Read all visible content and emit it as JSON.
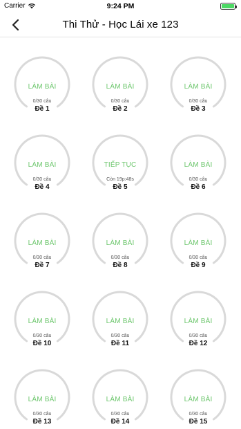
{
  "status_bar": {
    "carrier": "Carrier",
    "time": "9:24 PM"
  },
  "nav": {
    "title": "Thi Thử - Học Lái xe 123"
  },
  "exams": [
    {
      "action": "LÀM BÀI",
      "progress": "0/30 câu",
      "name": "Đề 1"
    },
    {
      "action": "LÀM BÀI",
      "progress": "0/30 câu",
      "name": "Đề 2"
    },
    {
      "action": "LÀM BÀI",
      "progress": "0/30 câu",
      "name": "Đề 3"
    },
    {
      "action": "LÀM BÀI",
      "progress": "0/30 câu",
      "name": "Đề 4"
    },
    {
      "action": "TIẾP TỤC",
      "progress": "Còn 19p:48s",
      "name": "Đề 5"
    },
    {
      "action": "LÀM BÀI",
      "progress": "0/30 câu",
      "name": "Đề 6"
    },
    {
      "action": "LÀM BÀI",
      "progress": "0/30 câu",
      "name": "Đề 7"
    },
    {
      "action": "LÀM BÀI",
      "progress": "0/30 câu",
      "name": "Đề 8"
    },
    {
      "action": "LÀM BÀI",
      "progress": "0/30 câu",
      "name": "Đề 9"
    },
    {
      "action": "LÀM BÀI",
      "progress": "0/30 câu",
      "name": "Đề 10"
    },
    {
      "action": "LÀM BÀI",
      "progress": "0/30 câu",
      "name": "Đề 11"
    },
    {
      "action": "LÀM BÀI",
      "progress": "0/30 câu",
      "name": "Đề 12"
    },
    {
      "action": "LÀM BÀI",
      "progress": "0/30 câu",
      "name": "Đề 13"
    },
    {
      "action": "LÀM BÀI",
      "progress": "0/30 câu",
      "name": "Đề 14"
    },
    {
      "action": "LÀM BÀI",
      "progress": "0/30 câu",
      "name": "Đề 15"
    }
  ],
  "colors": {
    "accent": "#6cc66c",
    "ring": "#d9d9d9",
    "battery": "#4cd964"
  },
  "icons": {
    "back": "chevron-left-icon",
    "wifi": "wifi-icon",
    "battery": "battery-icon"
  }
}
